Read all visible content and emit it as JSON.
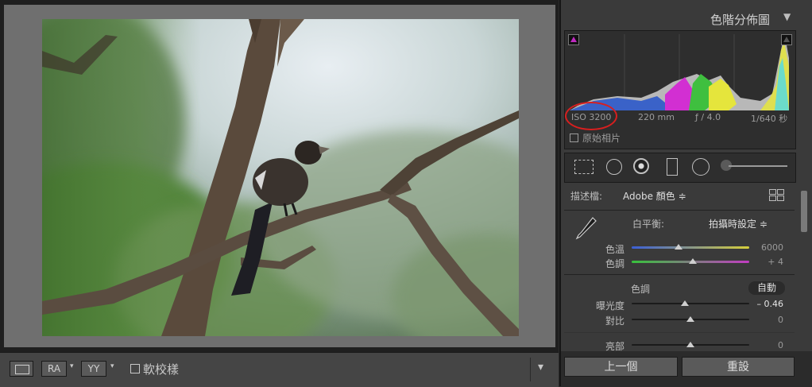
{
  "histogram": {
    "title": "色階分佈圖",
    "iso": "ISO 3200",
    "focal": "220 mm",
    "aperture": "ƒ / 4.0",
    "shutter": "1/640 秒",
    "original_photo_label": "原始相片"
  },
  "profile": {
    "label": "描述檔:",
    "value": "Adobe 顏色 ≑"
  },
  "white_balance": {
    "label": "白平衡:",
    "value": "拍攝時設定 ≑",
    "temp_label": "色溫",
    "temp_value": "6000",
    "temp_level": 0.4,
    "tint_label": "色調",
    "tint_value": "+ 4",
    "tint_level": 0.52
  },
  "tone": {
    "title": "色調",
    "auto_label": "自動",
    "exposure_label": "曝光度",
    "exposure_value": "– 0.46",
    "exposure_level": 0.45,
    "contrast_label": "對比",
    "contrast_value": "0",
    "contrast_level": 0.5,
    "highlights_label": "亮部",
    "highlights_value": "0",
    "highlights_level": 0.5
  },
  "buttons": {
    "previous": "上一個",
    "reset": "重設"
  },
  "toolbar": {
    "soft_proof_label": "軟校樣",
    "ra_label": "RA",
    "yy_label": "YY"
  },
  "colors": {
    "annotation_circle": "#d81f1f"
  }
}
